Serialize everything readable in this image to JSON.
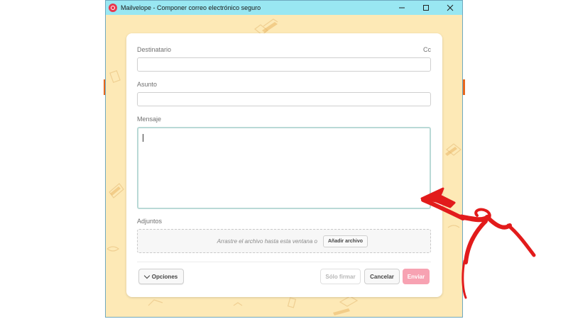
{
  "window": {
    "title": "Mailvelope - Componer correo electrónico seguro",
    "controls": {
      "minimize_icon": "minimize-icon",
      "maximize_icon": "maximize-icon",
      "close_icon": "close-icon"
    }
  },
  "compose": {
    "recipient_label": "Destinatario",
    "cc_label": "Cc",
    "recipient_value": "",
    "subject_label": "Asunto",
    "subject_value": "",
    "message_label": "Mensaje",
    "message_value": "",
    "attachments_label": "Adjuntos",
    "drop_text": "Arrastre el archivo hasta esta ventana o",
    "add_file_label": "Añadir archivo"
  },
  "footer": {
    "options_label": "Opciones",
    "sign_only_label": "Sólo firmar",
    "cancel_label": "Cancelar",
    "send_label": "Enviar"
  },
  "colors": {
    "titlebar": "#99e7f2",
    "background": "#fde9b6",
    "send_button": "#f7a2b2",
    "annotation_arrow": "#e21b1b"
  }
}
